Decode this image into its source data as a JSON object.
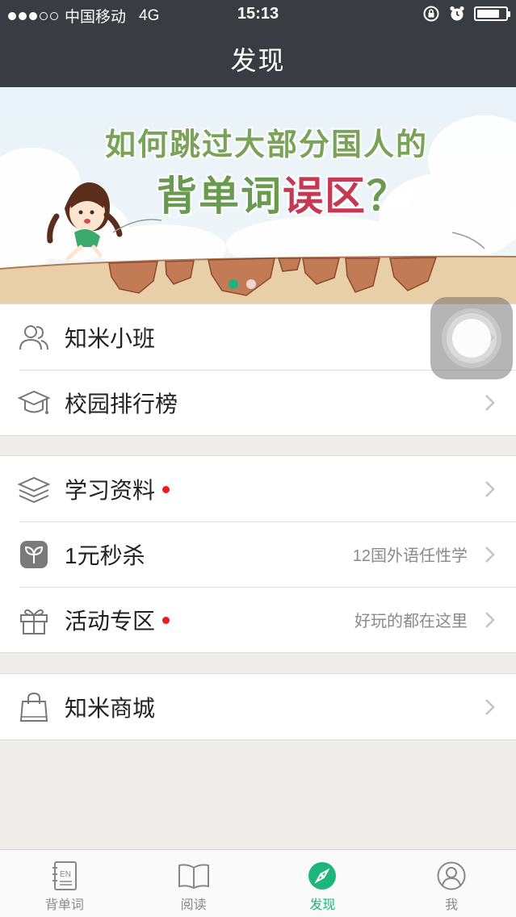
{
  "status_bar": {
    "carrier": "中国移动",
    "network": "4G",
    "time": "15:13"
  },
  "nav": {
    "title": "发现"
  },
  "banner": {
    "line1": "如何跳过大部分国人的",
    "line2_normal": "背单词",
    "line2_highlight": "误区",
    "line2_end": "？",
    "page_count": 2,
    "active_page": 1
  },
  "groups": [
    {
      "rows": [
        {
          "icon": "people-icon",
          "label": "知米小班",
          "red_dot": false,
          "sub": ""
        },
        {
          "icon": "graduation-cap-icon",
          "label": "校园排行榜",
          "red_dot": false,
          "sub": ""
        }
      ]
    },
    {
      "rows": [
        {
          "icon": "layers-icon",
          "label": "学习资料",
          "red_dot": true,
          "sub": ""
        },
        {
          "icon": "leaf-icon",
          "label": "1元秒杀",
          "red_dot": false,
          "sub": "12国外语任性学"
        },
        {
          "icon": "gift-icon",
          "label": "活动专区",
          "red_dot": true,
          "sub": "好玩的都在这里"
        }
      ]
    },
    {
      "rows": [
        {
          "icon": "shopping-bag-icon",
          "label": "知米商城",
          "red_dot": false,
          "sub": ""
        }
      ]
    }
  ],
  "tabbar": {
    "items": [
      {
        "icon": "notebook-en-icon",
        "label": "背单词",
        "icon_text": "EN",
        "active": false
      },
      {
        "icon": "book-icon",
        "label": "阅读",
        "active": false
      },
      {
        "icon": "compass-icon",
        "label": "发现",
        "active": true
      },
      {
        "icon": "profile-icon",
        "label": "我",
        "active": false
      }
    ]
  },
  "colors": {
    "nav_bg": "#3a3c44",
    "accent": "#1db57c",
    "red_dot": "#f01a1a",
    "banner_green": "#6a9a50",
    "banner_red": "#c43a52"
  }
}
